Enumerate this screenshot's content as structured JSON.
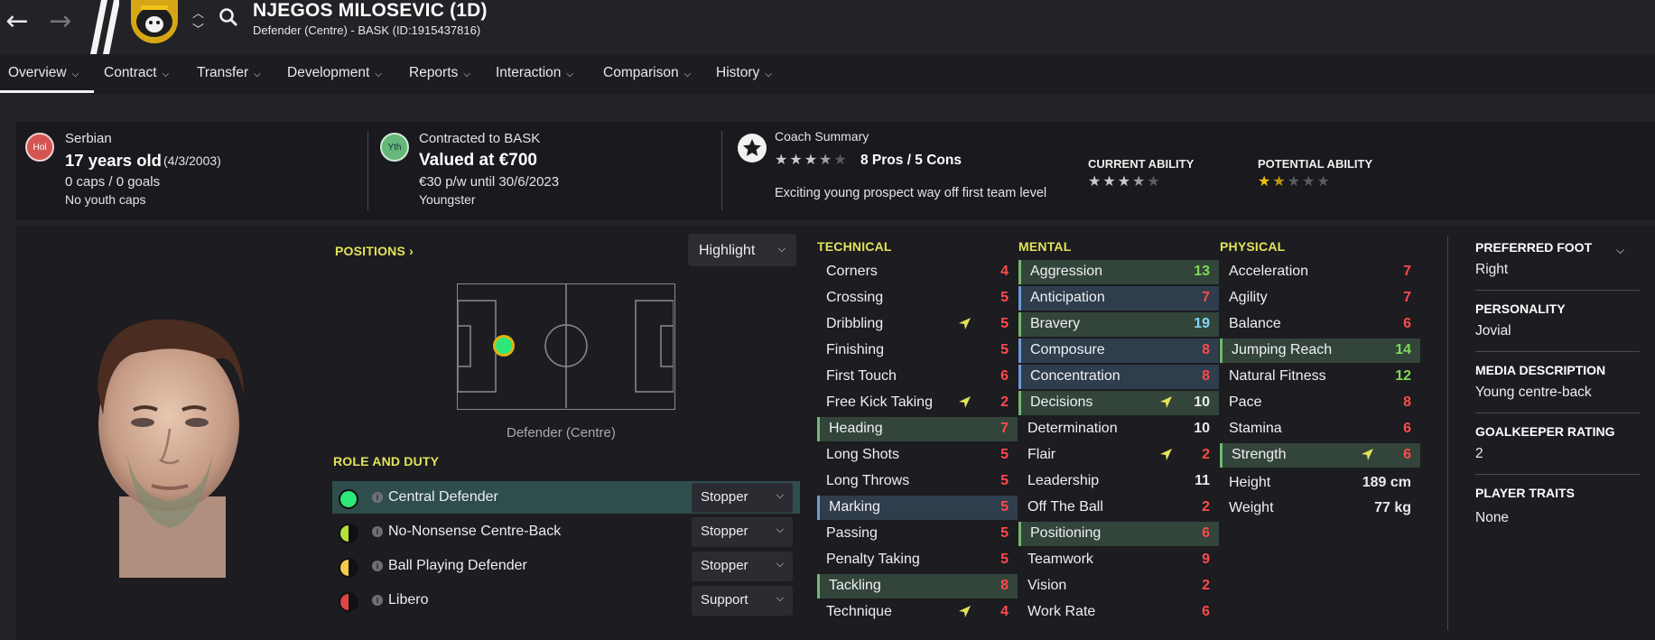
{
  "header": {
    "player_name": "NJEGOS MILOSEVIC (1D)",
    "subtitle": "Defender (Centre) - BASK (ID:1915437816)"
  },
  "tabs": [
    "Overview",
    "Contract",
    "Transfer",
    "Development",
    "Reports",
    "Interaction",
    "Comparison",
    "History"
  ],
  "info": {
    "nat_badge": "Hol",
    "nationality": "Serbian",
    "age": "17 years old",
    "dob": "(4/3/2003)",
    "caps": "0 caps / 0 goals",
    "youth_caps": "No youth caps",
    "status_badge": "Yth",
    "contract": "Contracted to BASK",
    "value": "Valued at €700",
    "wage": "€30 p/w until 30/6/2023",
    "status": "Youngster",
    "coach_title": "Coach Summary",
    "pros_cons": "8 Pros / 5 Cons",
    "coach_text": "Exciting young prospect way off first team level",
    "ca_label": "CURRENT ABILITY",
    "pa_label": "POTENTIAL ABILITY",
    "coach_stars": 3.5,
    "ca_stars": 3.5,
    "pa_stars": 1.5
  },
  "positions": {
    "title": "POSITIONS",
    "highlight": "Highlight",
    "pos_label": "Defender (Centre)"
  },
  "roles": {
    "title": "ROLE AND DUTY",
    "items": [
      {
        "name": "Central Defender",
        "duty": "Stopper",
        "color": "#2ee87a"
      },
      {
        "name": "No-Nonsense Centre-Back",
        "duty": "Stopper",
        "color": "#b6e03a"
      },
      {
        "name": "Ball Playing Defender",
        "duty": "Stopper",
        "color": "#f2c94c"
      },
      {
        "name": "Libero",
        "duty": "Support",
        "color": "#e04545"
      }
    ]
  },
  "attributes": {
    "technical": {
      "title": "TECHNICAL",
      "rows": [
        {
          "name": "Corners",
          "value": "4",
          "color": "red",
          "hl": "",
          "tri": false
        },
        {
          "name": "Crossing",
          "value": "5",
          "color": "red",
          "hl": "",
          "tri": false
        },
        {
          "name": "Dribbling",
          "value": "5",
          "color": "red",
          "hl": "",
          "tri": true
        },
        {
          "name": "Finishing",
          "value": "5",
          "color": "red",
          "hl": "",
          "tri": false
        },
        {
          "name": "First Touch",
          "value": "6",
          "color": "red",
          "hl": "",
          "tri": false
        },
        {
          "name": "Free Kick Taking",
          "value": "2",
          "color": "red",
          "hl": "",
          "tri": true
        },
        {
          "name": "Heading",
          "value": "7",
          "color": "red",
          "hl": "green",
          "tri": false
        },
        {
          "name": "Long Shots",
          "value": "5",
          "color": "red",
          "hl": "",
          "tri": false
        },
        {
          "name": "Long Throws",
          "value": "5",
          "color": "red",
          "hl": "",
          "tri": false
        },
        {
          "name": "Marking",
          "value": "5",
          "color": "red",
          "hl": "blue",
          "tri": false
        },
        {
          "name": "Passing",
          "value": "5",
          "color": "red",
          "hl": "",
          "tri": false
        },
        {
          "name": "Penalty Taking",
          "value": "5",
          "color": "red",
          "hl": "",
          "tri": false
        },
        {
          "name": "Tackling",
          "value": "8",
          "color": "red",
          "hl": "green",
          "tri": false
        },
        {
          "name": "Technique",
          "value": "4",
          "color": "red",
          "hl": "",
          "tri": true
        }
      ]
    },
    "mental": {
      "title": "MENTAL",
      "rows": [
        {
          "name": "Aggression",
          "value": "13",
          "color": "green",
          "hl": "green",
          "tri": false
        },
        {
          "name": "Anticipation",
          "value": "7",
          "color": "red",
          "hl": "blue",
          "tri": false
        },
        {
          "name": "Bravery",
          "value": "19",
          "color": "cyan",
          "hl": "green",
          "tri": false
        },
        {
          "name": "Composure",
          "value": "8",
          "color": "red",
          "hl": "blue",
          "tri": false
        },
        {
          "name": "Concentration",
          "value": "8",
          "color": "red",
          "hl": "blue",
          "tri": false
        },
        {
          "name": "Decisions",
          "value": "10",
          "color": "white",
          "hl": "green",
          "tri": true
        },
        {
          "name": "Determination",
          "value": "10",
          "color": "white",
          "hl": "",
          "tri": false
        },
        {
          "name": "Flair",
          "value": "2",
          "color": "red",
          "hl": "",
          "tri": true
        },
        {
          "name": "Leadership",
          "value": "11",
          "color": "white",
          "hl": "",
          "tri": false
        },
        {
          "name": "Off The Ball",
          "value": "2",
          "color": "red",
          "hl": "",
          "tri": false
        },
        {
          "name": "Positioning",
          "value": "6",
          "color": "red",
          "hl": "green",
          "tri": false
        },
        {
          "name": "Teamwork",
          "value": "9",
          "color": "red",
          "hl": "",
          "tri": false
        },
        {
          "name": "Vision",
          "value": "2",
          "color": "red",
          "hl": "",
          "tri": false
        },
        {
          "name": "Work Rate",
          "value": "6",
          "color": "red",
          "hl": "",
          "tri": false
        }
      ]
    },
    "physical": {
      "title": "PHYSICAL",
      "rows": [
        {
          "name": "Acceleration",
          "value": "7",
          "color": "red",
          "hl": "",
          "tri": false
        },
        {
          "name": "Agility",
          "value": "7",
          "color": "red",
          "hl": "",
          "tri": false
        },
        {
          "name": "Balance",
          "value": "6",
          "color": "red",
          "hl": "",
          "tri": false
        },
        {
          "name": "Jumping Reach",
          "value": "14",
          "color": "green",
          "hl": "green",
          "tri": false
        },
        {
          "name": "Natural Fitness",
          "value": "12",
          "color": "green",
          "hl": "",
          "tri": false
        },
        {
          "name": "Pace",
          "value": "8",
          "color": "red",
          "hl": "",
          "tri": false
        },
        {
          "name": "Stamina",
          "value": "6",
          "color": "red",
          "hl": "",
          "tri": false
        },
        {
          "name": "Strength",
          "value": "6",
          "color": "red",
          "hl": "green",
          "tri": true
        }
      ]
    },
    "height_label": "Height",
    "height": "189 cm",
    "weight_label": "Weight",
    "weight": "77 kg"
  },
  "side": {
    "foot_label": "PREFERRED FOOT",
    "foot": "Right",
    "personality_label": "PERSONALITY",
    "personality": "Jovial",
    "media_label": "MEDIA DESCRIPTION",
    "media": "Young centre-back",
    "gk_label": "GOALKEEPER RATING",
    "gk": "2",
    "traits_label": "PLAYER TRAITS",
    "traits": "None"
  }
}
